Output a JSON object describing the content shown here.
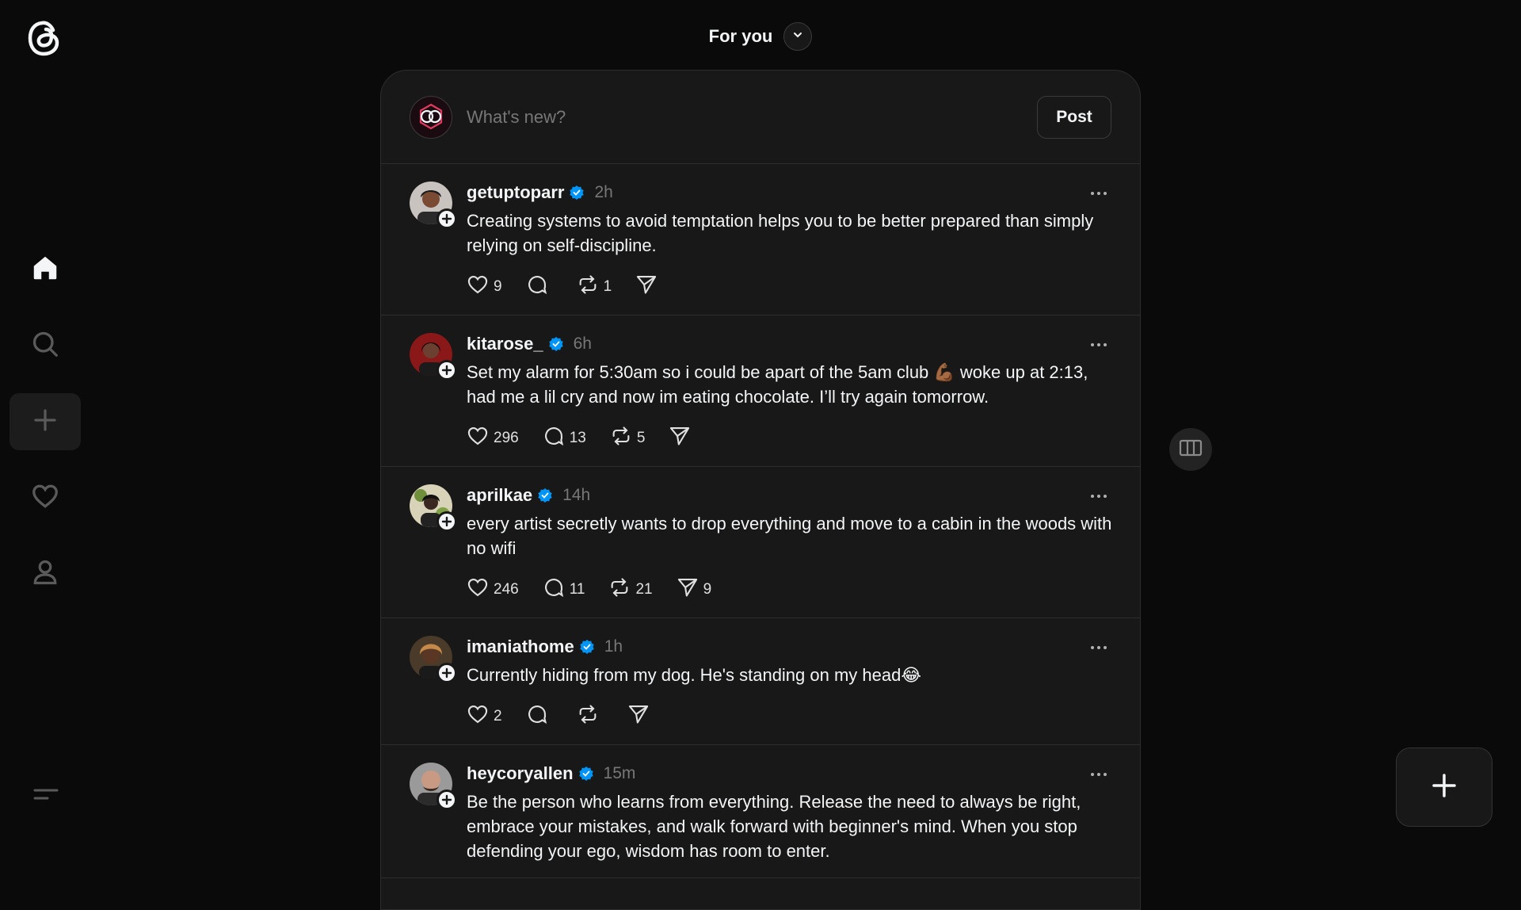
{
  "header": {
    "feed_title": "For you"
  },
  "sidebar": {
    "logo": "threads-logo-icon",
    "items": [
      {
        "name": "home",
        "icon": "home-icon"
      },
      {
        "name": "search",
        "icon": "search-icon"
      },
      {
        "name": "create",
        "icon": "plus-icon"
      },
      {
        "name": "activity",
        "icon": "heart-icon"
      },
      {
        "name": "profile",
        "icon": "person-icon"
      }
    ],
    "menu_icon": "menu-icon"
  },
  "composer": {
    "placeholder": "What's new?",
    "post_label": "Post"
  },
  "posts": [
    {
      "username": "getuptoparr",
      "time": "2h",
      "text": "Creating systems to avoid temptation helps you to be better prepared than simply relying on self-discipline.",
      "likes": "9",
      "replies": "",
      "reposts": "1",
      "shares": ""
    },
    {
      "username": "kitarose_",
      "time": "6h",
      "text": "Set my alarm for 5:30am so i could be apart of the 5am club 💪🏾 woke up at 2:13, had me a lil cry and now im eating chocolate. I’ll try again tomorrow.",
      "likes": "296",
      "replies": "13",
      "reposts": "5",
      "shares": ""
    },
    {
      "username": "aprilkae",
      "time": "14h",
      "text": "every artist secretly wants to drop everything and move to a cabin in the woods with no wifi",
      "likes": "246",
      "replies": "11",
      "reposts": "21",
      "shares": "9"
    },
    {
      "username": "imaniathome",
      "time": "1h",
      "text": "Currently hiding from my dog. He's standing on my head😂",
      "likes": "2",
      "replies": "",
      "reposts": "",
      "shares": ""
    },
    {
      "username": "heycoryallen",
      "time": "15m",
      "text": "Be the person who learns from everything. Release the need to always be right, embrace your mistakes, and walk forward with beginner's mind. When you stop defending your ego, wisdom has room to enter.",
      "likes": "",
      "replies": "",
      "reposts": "",
      "shares": ""
    }
  ],
  "colors": {
    "background": "#0a0a0a",
    "card": "#181818",
    "border": "#2d2d2d",
    "text": "#f3f5f7",
    "muted": "#777777",
    "verified": "#0095f6"
  }
}
